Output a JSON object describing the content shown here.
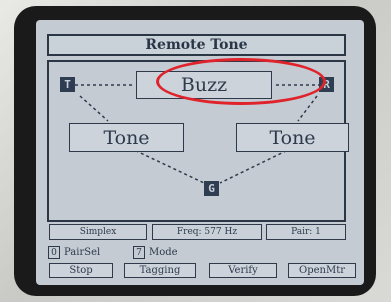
{
  "screen": {
    "title": "Remote Tone",
    "center_button": "Buzz",
    "left_button": "Tone",
    "right_button": "Tone",
    "markers": {
      "left": "T",
      "right": "R",
      "bottom": "G"
    },
    "status": {
      "mode": "Simplex",
      "freq": "Freq: 577 Hz",
      "pair": "Pair:   1"
    },
    "keys": [
      {
        "key": "0",
        "label": "PairSel"
      },
      {
        "key": "7",
        "label": "Mode"
      }
    ],
    "softkeys": [
      "Stop",
      "Tagging",
      "Verify",
      "OpenMtr"
    ]
  },
  "colors": {
    "lcd_bg": "#c4cbd3",
    "ink": "#2e3a4c",
    "highlight": "#e0232b"
  }
}
